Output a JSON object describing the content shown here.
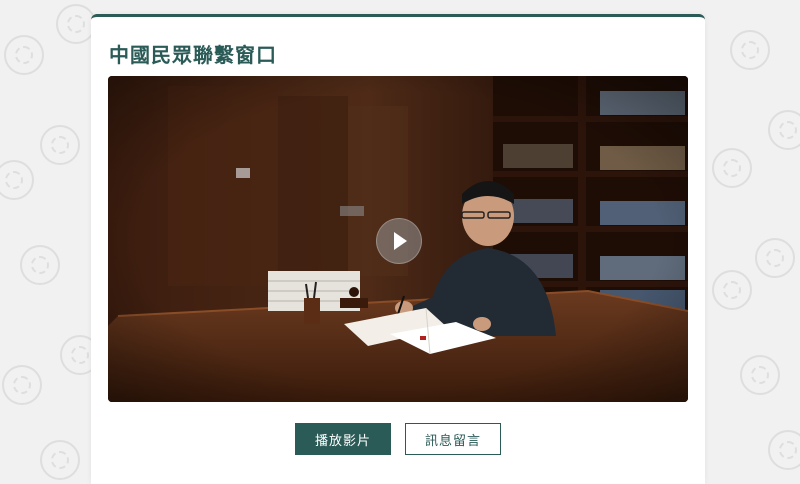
{
  "page": {
    "title": "中國民眾聯繫窗口"
  },
  "video": {
    "play_icon": "play-icon"
  },
  "actions": {
    "play_label": "播放影片",
    "message_label": "訊息留言"
  },
  "colors": {
    "accent": "#2b5b57",
    "background": "#f1f1f1",
    "card": "#ffffff"
  }
}
